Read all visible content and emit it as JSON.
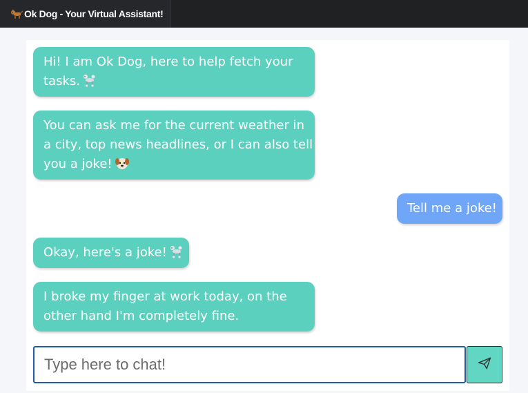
{
  "app": {
    "tab_title": "Ok Dog - Your Virtual Assistant!"
  },
  "chat": {
    "messages": [
      {
        "sender": "bot",
        "lines": [
          "Hi! I am Ok Dog, here to help fetch your",
          "tasks."
        ],
        "emoji": "poodle-emoji"
      },
      {
        "sender": "bot",
        "lines": [
          "You can ask me for the current weather in",
          "a city, top news headlines, or I can also tell",
          "you a joke!"
        ],
        "emoji": "dog-face-emoji"
      },
      {
        "sender": "user",
        "lines": [
          "Tell me a joke!"
        ]
      },
      {
        "sender": "bot",
        "lines": [
          "Okay, here's a joke!"
        ],
        "emoji": "poodle-emoji"
      },
      {
        "sender": "bot",
        "lines": [
          "I broke my finger at work today, on the",
          "other hand I'm completely fine."
        ]
      }
    ]
  },
  "input": {
    "placeholder": "Type here to chat!",
    "value": ""
  },
  "send_button": {
    "icon": "paper-plane-icon"
  },
  "colors": {
    "bot_bubble": "#5bd0be",
    "user_bubble": "#70a6f7",
    "send_button": "#61d6c2",
    "input_border": "#1f5da8",
    "topbar": "#202123"
  }
}
